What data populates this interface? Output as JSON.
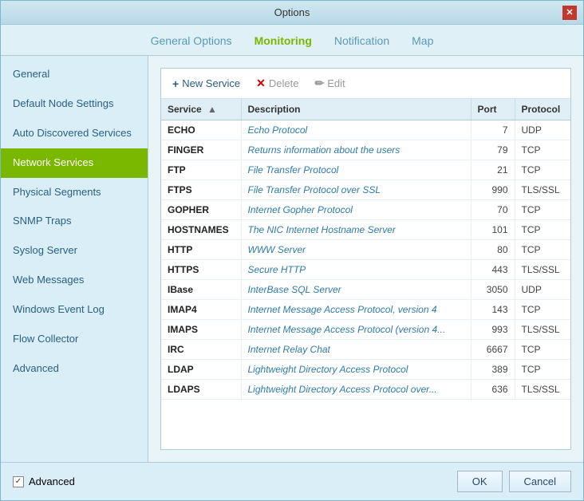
{
  "window": {
    "title": "Options",
    "close_label": "✕"
  },
  "tabs": [
    {
      "id": "general-options",
      "label": "General Options",
      "active": false
    },
    {
      "id": "monitoring",
      "label": "Monitoring",
      "active": true
    },
    {
      "id": "notification",
      "label": "Notification",
      "active": false
    },
    {
      "id": "map",
      "label": "Map",
      "active": false
    }
  ],
  "sidebar": {
    "items": [
      {
        "id": "general",
        "label": "General"
      },
      {
        "id": "default-node-settings",
        "label": "Default Node Settings"
      },
      {
        "id": "auto-discovered-services",
        "label": "Auto Discovered Services"
      },
      {
        "id": "network-services",
        "label": "Network Services",
        "active": true
      },
      {
        "id": "physical-segments",
        "label": "Physical Segments"
      },
      {
        "id": "snmp-traps",
        "label": "SNMP Traps"
      },
      {
        "id": "syslog-server",
        "label": "Syslog Server"
      },
      {
        "id": "web-messages",
        "label": "Web Messages"
      },
      {
        "id": "windows-event-log",
        "label": "Windows Event Log"
      },
      {
        "id": "flow-collector",
        "label": "Flow Collector"
      },
      {
        "id": "advanced",
        "label": "Advanced"
      }
    ]
  },
  "toolbar": {
    "new_service_label": "New Service",
    "delete_label": "Delete",
    "edit_label": "Edit"
  },
  "table": {
    "headers": [
      {
        "id": "service",
        "label": "Service",
        "sortable": true
      },
      {
        "id": "description",
        "label": "Description"
      },
      {
        "id": "port",
        "label": "Port"
      },
      {
        "id": "protocol",
        "label": "Protocol"
      }
    ],
    "rows": [
      {
        "service": "ECHO",
        "description": "Echo Protocol",
        "port": "7",
        "protocol": "UDP"
      },
      {
        "service": "FINGER",
        "description": "Returns information about the users",
        "port": "79",
        "protocol": "TCP"
      },
      {
        "service": "FTP",
        "description": "File Transfer Protocol",
        "port": "21",
        "protocol": "TCP"
      },
      {
        "service": "FTPS",
        "description": "File Transfer Protocol over SSL",
        "port": "990",
        "protocol": "TLS/SSL"
      },
      {
        "service": "GOPHER",
        "description": "Internet Gopher Protocol",
        "port": "70",
        "protocol": "TCP"
      },
      {
        "service": "HOSTNAMES",
        "description": "The NIC Internet Hostname Server",
        "port": "101",
        "protocol": "TCP"
      },
      {
        "service": "HTTP",
        "description": "WWW Server",
        "port": "80",
        "protocol": "TCP"
      },
      {
        "service": "HTTPS",
        "description": "Secure HTTP",
        "port": "443",
        "protocol": "TLS/SSL"
      },
      {
        "service": "IBase",
        "description": "InterBase SQL Server",
        "port": "3050",
        "protocol": "UDP"
      },
      {
        "service": "IMAP4",
        "description": "Internet Message Access Protocol, version 4",
        "port": "143",
        "protocol": "TCP"
      },
      {
        "service": "IMAPS",
        "description": "Internet Message Access Protocol (version 4...",
        "port": "993",
        "protocol": "TLS/SSL"
      },
      {
        "service": "IRC",
        "description": "Internet Relay Chat",
        "port": "6667",
        "protocol": "TCP"
      },
      {
        "service": "LDAP",
        "description": "Lightweight Directory Access Protocol",
        "port": "389",
        "protocol": "TCP"
      },
      {
        "service": "LDAPS",
        "description": "Lightweight Directory Access Protocol over...",
        "port": "636",
        "protocol": "TLS/SSL"
      }
    ]
  },
  "footer": {
    "advanced_checkbox_label": "Advanced",
    "advanced_checked": true,
    "ok_label": "OK",
    "cancel_label": "Cancel"
  },
  "colors": {
    "active_tab": "#7ab800",
    "active_sidebar": "#7ab800",
    "close_btn": "#c0392b"
  }
}
